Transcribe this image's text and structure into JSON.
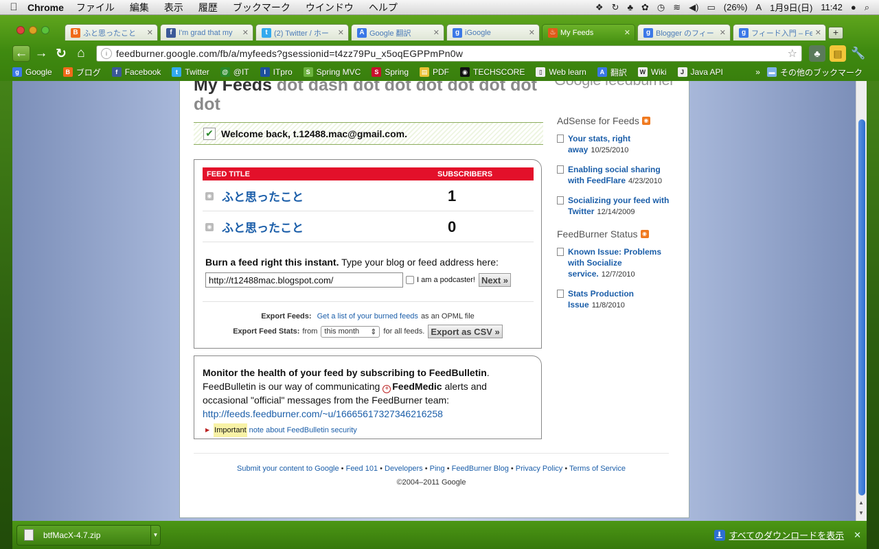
{
  "menubar": {
    "app_name": "Chrome",
    "items": [
      "ファイル",
      "編集",
      "表示",
      "履歴",
      "ブックマーク",
      "ウインドウ",
      "ヘルプ"
    ],
    "battery": "(26%)",
    "date": "1月9日(日)",
    "time": "11:42"
  },
  "tabs": [
    {
      "label": "ふと思ったこと",
      "icon": "blogger-icon",
      "color": "#f06a1a",
      "glyph": "B"
    },
    {
      "label": "I'm grad that my",
      "icon": "facebook-icon",
      "color": "#3b5998",
      "glyph": "f"
    },
    {
      "label": "(2) Twitter / ホー",
      "icon": "twitter-icon",
      "color": "#33aaee",
      "glyph": "t"
    },
    {
      "label": "Google 翻訳",
      "icon": "translate-icon",
      "color": "#3b78e7",
      "glyph": "A"
    },
    {
      "label": "iGoogle",
      "icon": "google-icon",
      "color": "#3b78e7",
      "glyph": "g"
    },
    {
      "label": "My Feeds",
      "icon": "feedburner-icon",
      "color": "#e05a1a",
      "glyph": "♨"
    },
    {
      "label": "Blogger のフィー",
      "icon": "google-icon",
      "color": "#3b78e7",
      "glyph": "g"
    },
    {
      "label": "フィード入門 – Fe",
      "icon": "google-icon",
      "color": "#3b78e7",
      "glyph": "g"
    }
  ],
  "address": {
    "url": "feedburner.google.com/fb/a/myfeeds?gsessionid=t4zz79Pu_x5oqEGPPmPn0w"
  },
  "bookmarks": [
    {
      "label": "Google",
      "icon": "google-icon",
      "color": "#3b78e7",
      "glyph": "g"
    },
    {
      "label": "ブログ",
      "icon": "blogger-icon",
      "color": "#f06a1a",
      "glyph": "B"
    },
    {
      "label": "Facebook",
      "icon": "facebook-icon",
      "color": "#3b5998",
      "glyph": "f"
    },
    {
      "label": "Twitter",
      "icon": "twitter-icon",
      "color": "#33aaee",
      "glyph": "t"
    },
    {
      "label": "@IT",
      "icon": "atmark-icon",
      "color": "#2a8a2a",
      "glyph": "@"
    },
    {
      "label": "ITpro",
      "icon": "itpro-icon",
      "color": "#1d4f9e",
      "glyph": "I"
    },
    {
      "label": "Spring MVC",
      "icon": "leaf-icon",
      "color": "#6db33f",
      "glyph": "S"
    },
    {
      "label": "Spring",
      "icon": "spring-icon",
      "color": "#c8102e",
      "glyph": "S"
    },
    {
      "label": "PDF",
      "icon": "folder-icon",
      "color": "#e8c234",
      "glyph": "▤"
    },
    {
      "label": "TECHSCORE",
      "icon": "techscore-icon",
      "color": "#111",
      "glyph": "◉"
    },
    {
      "label": "Web learn",
      "icon": "page-icon",
      "color": "#eee",
      "glyph": "▯"
    },
    {
      "label": "翻訳",
      "icon": "translate-icon",
      "color": "#3b78e7",
      "glyph": "A"
    },
    {
      "label": "Wiki",
      "icon": "wikipedia-icon",
      "color": "#eee",
      "glyph": "W"
    },
    {
      "label": "Java API",
      "icon": "java-icon",
      "color": "#eee",
      "glyph": "J"
    }
  ],
  "bookmarks_other": "その他のブックマーク",
  "page": {
    "title_main": "My Feeds",
    "title_dots": "dot dash dot dot dot dot dot dot dot",
    "logo": "Google feedburner",
    "welcome": "Welcome back, t.12488.mac@gmail.com.",
    "feed_table": {
      "headers": {
        "title": "FEED TITLE",
        "subscribers": "SUBSCRIBERS"
      },
      "rows": [
        {
          "title": "ふと思ったこと",
          "subscribers": "1"
        },
        {
          "title": "ふと思ったこと",
          "subscribers": "0"
        }
      ]
    },
    "burn": {
      "bold": "Burn a feed right this instant.",
      "text": " Type your blog or feed address here:",
      "input_value": "http://t12488mac.blogspot.com/",
      "podcaster_label": "I am a podcaster!",
      "next_label": "Next »"
    },
    "export": {
      "feeds_label": "Export Feeds:",
      "feeds_link": "Get a list of your burned feeds",
      "feeds_suffix": "as an OPML file",
      "stats_label": "Export Feed Stats:",
      "stats_from": "from",
      "stats_period": "this month",
      "stats_suffix": "for all feeds.",
      "csv_label": "Export as CSV »"
    },
    "monitor": {
      "lead": "Monitor the health of your feed by subscribing to FeedBulletin",
      "lead_end": ".",
      "text1": "FeedBulletin is our way of communicating",
      "medic": "FeedMedic",
      "text2": " alerts and occasional \"official\" messages from the FeedBurner team:",
      "link": "http://feeds.feedburner.com/~u/16665617327346216258",
      "important": "Important",
      "note": "note about FeedBulletin security"
    },
    "sidebar": {
      "adsense_title": "AdSense for Feeds",
      "adsense_items": [
        {
          "title": "Your stats, right away",
          "date": "10/25/2010"
        },
        {
          "title": "Enabling social sharing with FeedFlare",
          "date": "4/23/2010"
        },
        {
          "title": "Socializing your feed with Twitter",
          "date": "12/14/2009"
        }
      ],
      "status_title": "FeedBurner Status",
      "status_items": [
        {
          "title": "Known Issue: Problems with Socialize service.",
          "date": "12/7/2010"
        },
        {
          "title": "Stats Production Issue",
          "date": "11/8/2010"
        }
      ]
    },
    "footer": {
      "links": [
        "Submit your content to Google",
        "Feed 101",
        "Developers",
        "Ping",
        "FeedBurner Blog",
        "Privacy Policy",
        "Terms of Service"
      ],
      "copyright": "©2004–2011 Google"
    }
  },
  "download": {
    "filename": "btfMacX-4.7.zip",
    "show_all": "すべてのダウンロードを表示"
  }
}
